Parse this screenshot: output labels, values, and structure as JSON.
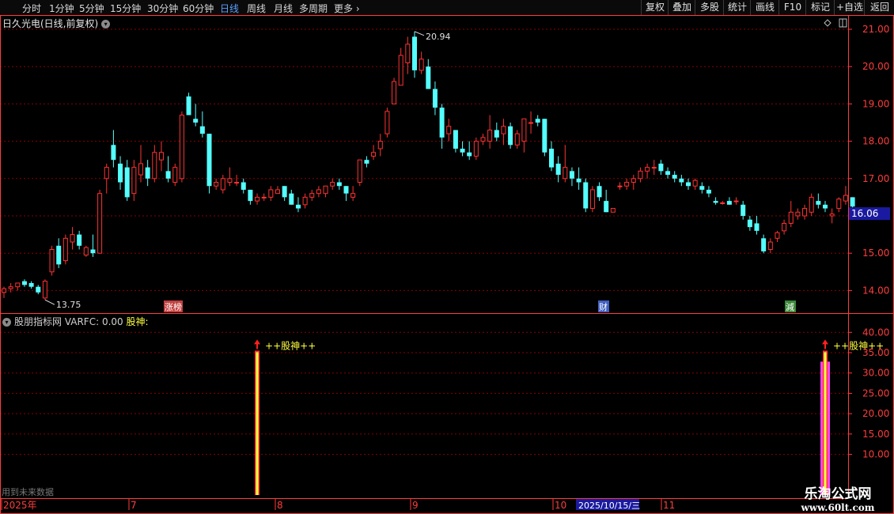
{
  "toolbar": {
    "periods": [
      "分时",
      "1分钟",
      "5分钟",
      "15分钟",
      "30分钟",
      "60分钟",
      "日线",
      "周线",
      "月线",
      "多周期",
      "更多"
    ],
    "active_period": "日线",
    "buttons": [
      "复权",
      "叠加",
      "多股",
      "统计",
      "画线",
      "F10",
      "标记",
      "+自选",
      "返回"
    ]
  },
  "main_chart": {
    "title": "日久光电(日线,前复权)",
    "price_axis_ticks": [
      "21.00",
      "20.00",
      "19.00",
      "18.00",
      "17.00",
      "16.00",
      "15.00",
      "14.00"
    ],
    "current_price_label": "16.06",
    "high_label": "20.94",
    "low_label": "13.75",
    "event_markers": [
      {
        "text": "涨榜",
        "color": "#c04040"
      },
      {
        "text": "财",
        "color": "#4060c0"
      },
      {
        "text": "減",
        "color": "#3a8a3a"
      }
    ]
  },
  "indicator": {
    "title_prefix": "股朋指标网 VARFC: 0.00",
    "title_suffix": "股神:",
    "signal_label": "++股神++",
    "axis_ticks": [
      "40.00",
      "35.00",
      "30.00",
      "25.00",
      "20.00",
      "15.00",
      "10.00"
    ],
    "future_data_note": "用到未来数据"
  },
  "date_axis": {
    "labels": [
      "2025年",
      "7",
      "8",
      "9",
      "10",
      "11"
    ],
    "cursor_date": "2025/10/15/三"
  },
  "watermark": {
    "line1": "乐淘公式网",
    "line2": "www.60lt.com"
  },
  "colors": {
    "up": "#ff3232",
    "down": "#54ffff",
    "grid": "#8b0000",
    "axis": "#ff3c3c",
    "signal_yellow": "#ffff40",
    "signal_magenta": "#ff40ff"
  },
  "chart_data": {
    "type": "candlestick",
    "y_range": [
      13.6,
      21.3
    ],
    "candles": [
      [
        13.95,
        14.1,
        13.8,
        14.05
      ],
      [
        14.05,
        14.2,
        13.95,
        14.1
      ],
      [
        14.1,
        14.2,
        14.0,
        14.2
      ],
      [
        14.25,
        14.3,
        14.1,
        14.15
      ],
      [
        14.2,
        14.25,
        14.05,
        14.1
      ],
      [
        14.1,
        14.15,
        13.9,
        13.95
      ],
      [
        13.8,
        14.3,
        13.75,
        14.25
      ],
      [
        14.5,
        15.2,
        14.4,
        15.1
      ],
      [
        15.2,
        15.4,
        14.6,
        14.7
      ],
      [
        14.8,
        15.5,
        14.7,
        15.4
      ],
      [
        15.3,
        15.7,
        15.1,
        15.5
      ],
      [
        15.5,
        15.6,
        15.1,
        15.2
      ],
      [
        14.95,
        15.2,
        14.9,
        15.15
      ],
      [
        15.1,
        15.5,
        14.9,
        15.0
      ],
      [
        15.0,
        16.7,
        15.0,
        16.6
      ],
      [
        17.0,
        17.4,
        16.6,
        17.3
      ],
      [
        17.9,
        18.3,
        17.3,
        17.5
      ],
      [
        17.4,
        17.6,
        16.7,
        16.9
      ],
      [
        17.3,
        17.5,
        16.4,
        16.5
      ],
      [
        16.6,
        17.5,
        16.4,
        17.3
      ],
      [
        17.1,
        17.9,
        16.9,
        17.4
      ],
      [
        17.3,
        17.5,
        16.8,
        17.0
      ],
      [
        17.0,
        17.9,
        16.9,
        17.7
      ],
      [
        17.5,
        18.0,
        17.2,
        17.7
      ],
      [
        17.2,
        17.6,
        16.9,
        17.0
      ],
      [
        16.9,
        17.4,
        16.8,
        17.3
      ],
      [
        17.0,
        18.8,
        16.9,
        18.7
      ],
      [
        19.2,
        19.3,
        18.7,
        18.7
      ],
      [
        18.6,
        19.0,
        18.4,
        18.5
      ],
      [
        18.4,
        18.8,
        18.1,
        18.2
      ],
      [
        18.2,
        18.2,
        16.6,
        16.8
      ],
      [
        16.8,
        17.0,
        16.7,
        16.9
      ],
      [
        16.7,
        17.1,
        16.6,
        17.0
      ],
      [
        16.9,
        17.3,
        16.8,
        17.0
      ],
      [
        16.9,
        17.1,
        16.8,
        16.9
      ],
      [
        16.9,
        17.0,
        16.6,
        16.7
      ],
      [
        16.7,
        16.7,
        16.3,
        16.4
      ],
      [
        16.4,
        16.6,
        16.3,
        16.5
      ],
      [
        16.5,
        16.6,
        16.4,
        16.5
      ],
      [
        16.5,
        16.8,
        16.4,
        16.7
      ],
      [
        16.6,
        16.8,
        16.6,
        16.7
      ],
      [
        16.8,
        16.8,
        16.4,
        16.5
      ],
      [
        16.6,
        16.7,
        16.3,
        16.3
      ],
      [
        16.3,
        16.5,
        16.1,
        16.2
      ],
      [
        16.3,
        16.6,
        16.2,
        16.5
      ],
      [
        16.5,
        16.7,
        16.4,
        16.6
      ],
      [
        16.6,
        16.8,
        16.5,
        16.7
      ],
      [
        16.6,
        16.8,
        16.5,
        16.8
      ],
      [
        16.8,
        17.0,
        16.7,
        16.9
      ],
      [
        16.9,
        17.0,
        16.7,
        16.8
      ],
      [
        16.8,
        16.8,
        16.4,
        16.6
      ],
      [
        16.5,
        16.8,
        16.4,
        16.6
      ],
      [
        16.9,
        17.5,
        16.8,
        17.5
      ],
      [
        17.5,
        17.6,
        17.3,
        17.4
      ],
      [
        17.6,
        17.9,
        17.5,
        17.7
      ],
      [
        17.8,
        18.2,
        17.6,
        18.0
      ],
      [
        18.2,
        18.9,
        18.1,
        18.8
      ],
      [
        19.0,
        19.7,
        19.0,
        19.6
      ],
      [
        19.5,
        20.5,
        19.5,
        20.3
      ],
      [
        20.1,
        20.8,
        19.8,
        20.6
      ],
      [
        20.8,
        20.94,
        19.7,
        19.9
      ],
      [
        19.9,
        20.4,
        19.8,
        20.2
      ],
      [
        20.0,
        20.2,
        19.4,
        19.4
      ],
      [
        19.4,
        19.6,
        18.7,
        18.9
      ],
      [
        18.9,
        19.0,
        17.8,
        18.1
      ],
      [
        18.2,
        18.6,
        18.0,
        18.4
      ],
      [
        18.3,
        18.3,
        17.7,
        17.8
      ],
      [
        17.8,
        18.0,
        17.6,
        17.7
      ],
      [
        17.7,
        18.0,
        17.5,
        17.6
      ],
      [
        17.6,
        18.1,
        17.5,
        18.0
      ],
      [
        18.0,
        18.2,
        17.9,
        18.1
      ],
      [
        18.0,
        18.7,
        17.8,
        18.3
      ],
      [
        18.3,
        18.5,
        18.0,
        18.1
      ],
      [
        18.2,
        18.6,
        17.9,
        18.4
      ],
      [
        18.4,
        18.5,
        17.8,
        17.9
      ],
      [
        17.9,
        18.3,
        17.8,
        18.2
      ],
      [
        18.0,
        18.6,
        17.7,
        18.6
      ],
      [
        18.5,
        18.8,
        18.2,
        18.5
      ],
      [
        18.6,
        18.7,
        18.4,
        18.5
      ],
      [
        18.6,
        18.6,
        17.6,
        17.7
      ],
      [
        17.8,
        18.0,
        17.2,
        17.3
      ],
      [
        17.4,
        17.6,
        16.9,
        17.1
      ],
      [
        17.0,
        17.9,
        16.9,
        17.3
      ],
      [
        17.2,
        17.3,
        16.8,
        17.0
      ],
      [
        17.0,
        17.3,
        16.7,
        16.9
      ],
      [
        16.9,
        17.0,
        16.1,
        16.2
      ],
      [
        16.2,
        16.8,
        16.1,
        16.7
      ],
      [
        16.8,
        16.9,
        16.4,
        16.5
      ],
      [
        16.4,
        16.7,
        16.1,
        16.1
      ],
      [
        16.1,
        16.2,
        16.1,
        16.2
      ],
      [
        16.8,
        16.9,
        16.7,
        16.8
      ],
      [
        16.8,
        17.0,
        16.7,
        16.9
      ],
      [
        16.9,
        17.1,
        16.7,
        17.0
      ],
      [
        17.0,
        17.3,
        16.9,
        17.2
      ],
      [
        17.2,
        17.4,
        17.0,
        17.3
      ],
      [
        17.3,
        17.5,
        17.1,
        17.3
      ],
      [
        17.4,
        17.5,
        17.1,
        17.2
      ],
      [
        17.2,
        17.3,
        17.0,
        17.1
      ],
      [
        17.1,
        17.2,
        16.9,
        17.0
      ],
      [
        17.0,
        17.1,
        16.8,
        16.9
      ],
      [
        16.9,
        17.0,
        16.7,
        16.8
      ],
      [
        16.8,
        17.0,
        16.7,
        16.95
      ],
      [
        16.8,
        16.9,
        16.6,
        16.7
      ],
      [
        16.7,
        16.8,
        16.5,
        16.6
      ],
      [
        16.4,
        16.5,
        16.3,
        16.35
      ],
      [
        16.35,
        16.4,
        16.3,
        16.35
      ],
      [
        16.4,
        16.5,
        16.3,
        16.3
      ],
      [
        16.4,
        16.5,
        16.3,
        16.4
      ],
      [
        16.3,
        16.4,
        15.9,
        16.0
      ],
      [
        15.9,
        16.0,
        15.6,
        15.7
      ],
      [
        15.8,
        16.0,
        15.5,
        15.6
      ],
      [
        15.4,
        15.5,
        15.0,
        15.05
      ],
      [
        15.1,
        15.4,
        15.0,
        15.3
      ],
      [
        15.4,
        15.6,
        15.3,
        15.55
      ],
      [
        15.6,
        15.9,
        15.5,
        15.8
      ],
      [
        15.8,
        16.4,
        15.7,
        16.1
      ],
      [
        16.0,
        16.2,
        15.9,
        16.1
      ],
      [
        16.0,
        16.3,
        15.9,
        16.2
      ],
      [
        16.1,
        16.6,
        16.0,
        16.5
      ],
      [
        16.4,
        16.6,
        16.2,
        16.3
      ],
      [
        16.3,
        16.4,
        16.1,
        16.2
      ],
      [
        16.0,
        16.2,
        15.8,
        16.05
      ],
      [
        16.2,
        16.5,
        16.1,
        16.45
      ],
      [
        16.4,
        16.8,
        16.3,
        16.55
      ],
      [
        16.5,
        16.5,
        16.2,
        16.25
      ]
    ],
    "indicator_series": {
      "name": "股神",
      "signals": [
        {
          "candle_index": 37,
          "value": 35.5
        },
        {
          "candle_index": 120,
          "value": 35.5
        }
      ]
    },
    "indicator_range": [
      0,
      42
    ]
  }
}
